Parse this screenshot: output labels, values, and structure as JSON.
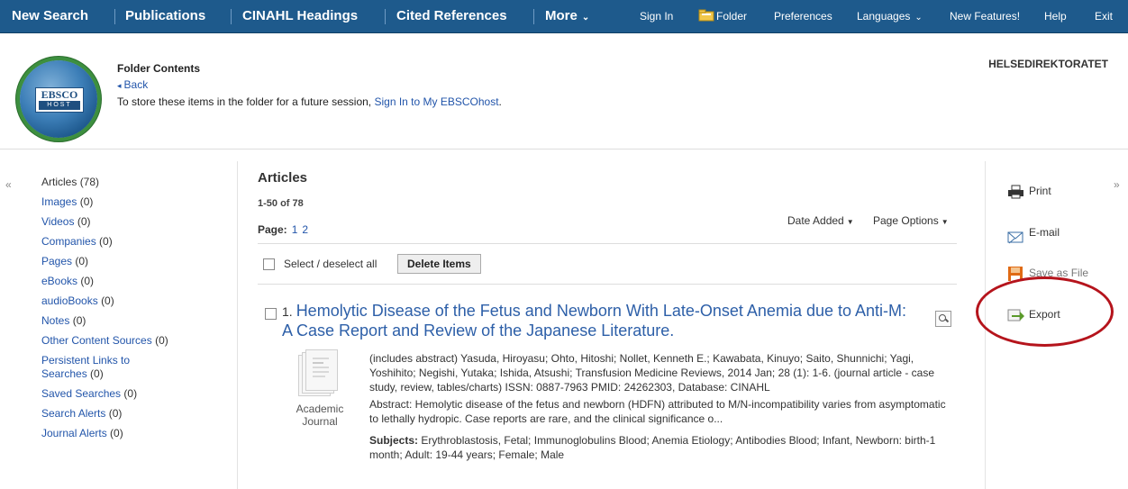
{
  "nav": {
    "left": [
      "New Search",
      "Publications",
      "CINAHL Headings",
      "Cited References",
      "More"
    ],
    "right": [
      "Sign In",
      "Folder",
      "Preferences",
      "Languages",
      "New Features!",
      "Help",
      "Exit"
    ]
  },
  "header": {
    "logo_line1": "EBSCO",
    "logo_line2": "HOST",
    "title": "Folder Contents",
    "back": "Back",
    "store_text": "To store these items in the folder for a future session, ",
    "store_link": "Sign In to My EBSCOhost",
    "store_end": ".",
    "org": "HELSEDIREKTORATET"
  },
  "sidebar": {
    "items": [
      {
        "label": "Articles",
        "count": "(78)"
      },
      {
        "label": "Images",
        "count": "(0)"
      },
      {
        "label": "Videos",
        "count": "(0)"
      },
      {
        "label": "Companies",
        "count": "(0)"
      },
      {
        "label": "Pages",
        "count": "(0)"
      },
      {
        "label": "eBooks",
        "count": "(0)"
      },
      {
        "label": "audioBooks",
        "count": "(0)"
      },
      {
        "label": "Notes",
        "count": "(0)"
      },
      {
        "label": "Other Content Sources",
        "count": "(0)"
      },
      {
        "label": "Persistent Links to Searches",
        "count": "(0)"
      },
      {
        "label": "Saved Searches",
        "count": "(0)"
      },
      {
        "label": "Search Alerts",
        "count": "(0)"
      },
      {
        "label": "Journal Alerts",
        "count": "(0)"
      }
    ]
  },
  "main": {
    "title": "Articles",
    "range": "1-50 of 78",
    "page_label": "Page:",
    "pages": [
      "1",
      "2"
    ],
    "sort": "Date Added",
    "page_options": "Page Options",
    "select_all": "Select / deselect all",
    "delete": "Delete Items",
    "result": {
      "number": "1.",
      "title": "Hemolytic Disease of the Fetus and Newborn With Late-Onset Anemia due to Anti-M: A Case Report and Review of the Japanese Literature.",
      "pub_type": "Academic Journal",
      "citation": "(includes abstract) Yasuda, Hiroyasu; Ohto, Hitoshi; Nollet, Kenneth E.; Kawabata, Kinuyo; Saito, Shunnichi; Yagi, Yoshihito; Negishi, Yutaka; Ishida, Atsushi; Transfusion Medicine Reviews, 2014 Jan; 28 (1): 1-6. (journal article - case study, review, tables/charts) ISSN: 0887-7963 PMID: 24262303, Database: CINAHL",
      "abstract": "Abstract: Hemolytic disease of the fetus and newborn (HDFN) attributed to M/N-incompatibility varies from asymptomatic to lethally hydropic. Case reports are rare, and the clinical significance o...",
      "subjects_label": "Subjects:",
      "subjects": " Erythroblastosis, Fetal; Immunoglobulins Blood; Anemia Etiology; Antibodies Blood; Infant, Newborn: birth-1 month; Adult: 19-44 years; Female; Male"
    }
  },
  "tools": {
    "print": "Print",
    "email": "E-mail",
    "save": "Save as File",
    "export": "Export"
  },
  "colors": {
    "nav_bg": "#1e5a8c",
    "link": "#2255aa",
    "highlight_circle": "#b5141c"
  }
}
